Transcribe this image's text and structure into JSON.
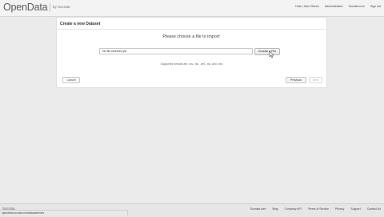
{
  "header": {
    "logo": "OpenData",
    "byline": "by Socrata",
    "nav": [
      "Hello, Sam Citizen",
      "Administration",
      "Socrata.com",
      "Sign out"
    ]
  },
  "dialog": {
    "title": "Create a new Dataset",
    "heading": "Please choose a file to import:",
    "file_placeholder": "No file selected yet",
    "choose_button": "Choose a File",
    "supported_formats": "Supported formats are .csv, .tsv, .xml, .xls, and .xlsx",
    "cancel_button": "Cancel",
    "previous_button": "Previous",
    "next_button": "Next"
  },
  "footer": {
    "socrata_mark": "Socrata",
    "links": [
      "Socrata.com",
      "Blog",
      "Company API",
      "Terms of Service",
      "Privacy",
      "Support",
      "Contact Us"
    ],
    "status_url": "opendata.socrata.com/datasets/new"
  },
  "colors": {
    "page_bg": "#ebebeb",
    "card_bg": "#ffffff",
    "header_bg": "#f3f3f3"
  }
}
